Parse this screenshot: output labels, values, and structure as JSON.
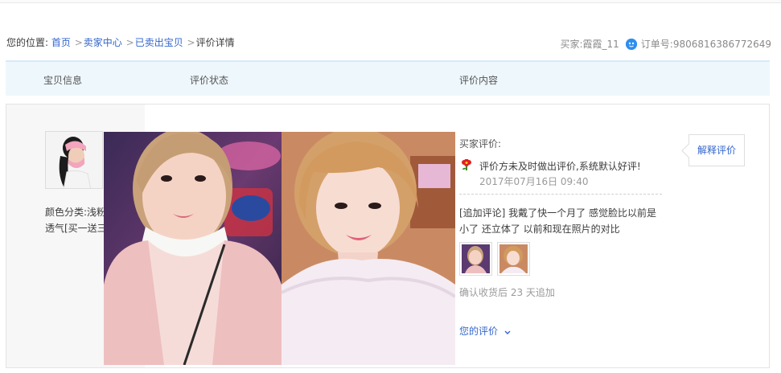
{
  "breadcrumb": {
    "prefix": "您的位置:",
    "items": [
      "首页",
      "卖家中心",
      "已卖出宝贝"
    ],
    "current": "评价详情",
    "separator": ">"
  },
  "order": {
    "buyer_label": "买家:",
    "buyer_name": "霞霞_11",
    "order_label": "订单号:",
    "order_number": "9806816386772649"
  },
  "table_header": {
    "col_item": "宝贝信息",
    "col_status": "评价状态",
    "col_content": "评价内容"
  },
  "item": {
    "desc_line1": "颜色分类:浅粉",
    "desc_line2": "透气[买一送三"
  },
  "review": {
    "buyer_review_label": "买家评价:",
    "default_text": "评价方未及时做出评价,系统默认好评!",
    "date": "2017年07月16日 09:40",
    "append_text": "[追加评论] 我戴了快一个月了 感觉脸比以前是小了 还立体了 以前和现在照片的对比",
    "confirm_text": "确认收货后 23 天追加",
    "your_review_label": "您的评价",
    "your_review_chevron": "chevron-down-icon"
  },
  "actions": {
    "explain_label": "解释评价"
  },
  "colors": {
    "link": "#3366cc",
    "header_bg": "#eef7fc",
    "muted": "#9a9a9a"
  },
  "icons": {
    "wangwang": "wangwang-chat-icon",
    "flower": "red-flower-icon"
  }
}
